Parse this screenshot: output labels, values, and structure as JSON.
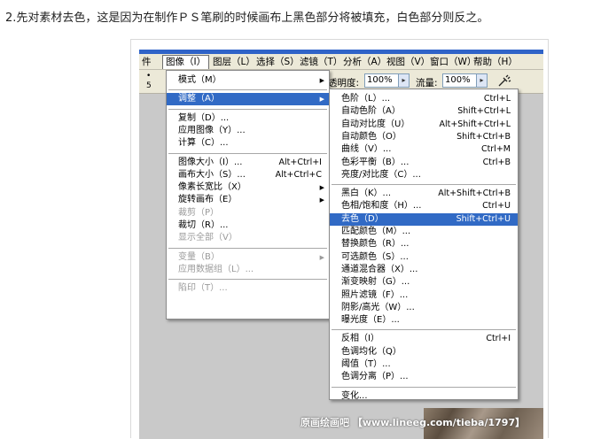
{
  "caption": "2.先对素材去色，这是因为在制作ＰＳ笔刷的时候画布上黑色部分将被填充，白色部分则反之。",
  "menubar": [
    "图像（I）",
    "图层（L）",
    "选择（S）",
    "滤镜（T）",
    "分析（A）",
    "视图（V）",
    "窗口（W）",
    "帮助（H）"
  ],
  "menubar_partial": "件",
  "options": {
    "opacity_label": "透明度:",
    "opacity_value": "100%",
    "flow_label": "流量:",
    "flow_value": "100%",
    "brush_size": "5",
    "arrow_glyph": "▸"
  },
  "image_menu": [
    {
      "label": "模式（M）",
      "shortcut": "",
      "submenu": true,
      "disabled": false
    },
    {
      "label": "调整（A）",
      "shortcut": "",
      "submenu": true,
      "disabled": false,
      "highlight": true
    },
    {
      "label": "复制（D）...",
      "shortcut": "",
      "submenu": false,
      "disabled": false
    },
    {
      "label": "应用图像（Y）...",
      "shortcut": "",
      "submenu": false,
      "disabled": false
    },
    {
      "label": "计算（C）...",
      "shortcut": "",
      "submenu": false,
      "disabled": false
    },
    {
      "label": "图像大小（I）...",
      "shortcut": "Alt+Ctrl+I",
      "submenu": false,
      "disabled": false
    },
    {
      "label": "画布大小（S）...",
      "shortcut": "Alt+Ctrl+C",
      "submenu": false,
      "disabled": false
    },
    {
      "label": "像素长宽比（X）",
      "shortcut": "",
      "submenu": true,
      "disabled": false
    },
    {
      "label": "旋转画布（E）",
      "shortcut": "",
      "submenu": true,
      "disabled": false
    },
    {
      "label": "裁剪（P）",
      "shortcut": "",
      "submenu": false,
      "disabled": true
    },
    {
      "label": "裁切（R）...",
      "shortcut": "",
      "submenu": false,
      "disabled": false
    },
    {
      "label": "显示全部（V）",
      "shortcut": "",
      "submenu": false,
      "disabled": true
    },
    {
      "label": "变量（B）",
      "shortcut": "",
      "submenu": true,
      "disabled": true
    },
    {
      "label": "应用数据组（L）...",
      "shortcut": "",
      "submenu": false,
      "disabled": true
    },
    {
      "label": "陷印（T）...",
      "shortcut": "",
      "submenu": false,
      "disabled": true
    }
  ],
  "adjust_menu": [
    {
      "label": "色阶（L）...",
      "shortcut": "Ctrl+L"
    },
    {
      "label": "自动色阶（A）",
      "shortcut": "Shift+Ctrl+L"
    },
    {
      "label": "自动对比度（U）",
      "shortcut": "Alt+Shift+Ctrl+L"
    },
    {
      "label": "自动颜色（O）",
      "shortcut": "Shift+Ctrl+B"
    },
    {
      "label": "曲线（V）...",
      "shortcut": "Ctrl+M"
    },
    {
      "label": "色彩平衡（B）...",
      "shortcut": "Ctrl+B"
    },
    {
      "label": "亮度/对比度（C）...",
      "shortcut": ""
    },
    {
      "label": "黑白（K）...",
      "shortcut": "Alt+Shift+Ctrl+B"
    },
    {
      "label": "色相/饱和度（H）...",
      "shortcut": "Ctrl+U"
    },
    {
      "label": "去色（D）",
      "shortcut": "Shift+Ctrl+U",
      "highlight": true
    },
    {
      "label": "匹配颜色（M）...",
      "shortcut": ""
    },
    {
      "label": "替换颜色（R）...",
      "shortcut": ""
    },
    {
      "label": "可选颜色（S）...",
      "shortcut": ""
    },
    {
      "label": "通道混合器（X）...",
      "shortcut": ""
    },
    {
      "label": "渐变映射（G）...",
      "shortcut": ""
    },
    {
      "label": "照片滤镜（F）...",
      "shortcut": ""
    },
    {
      "label": "阴影/高光（W）...",
      "shortcut": ""
    },
    {
      "label": "曝光度（E）...",
      "shortcut": ""
    },
    {
      "label": "反相（I）",
      "shortcut": "Ctrl+I"
    },
    {
      "label": "色调均化（Q）",
      "shortcut": ""
    },
    {
      "label": "阈值（T）...",
      "shortcut": ""
    },
    {
      "label": "色调分离（P）...",
      "shortcut": ""
    },
    {
      "label": "变化...",
      "shortcut": ""
    }
  ],
  "watermark": "原画绘画吧 【www.lineeg.com/tieba/1797】",
  "colors": {
    "highlight": "#316ac5",
    "titlebar": "#2f63c8",
    "menubar": "#ece9d8",
    "disabled": "#9a9a9a"
  }
}
